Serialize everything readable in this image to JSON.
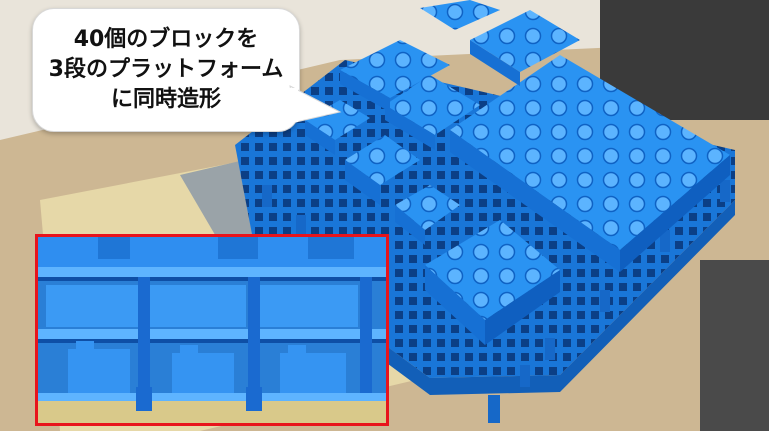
{
  "callout": {
    "lines": [
      "40個のブロックを",
      "3段のプラットフォーム",
      "に同時造形"
    ]
  },
  "colors": {
    "print_blue": "#1f8ef0",
    "inset_border": "#e8141c",
    "bubble_fill": "#ffffff",
    "bubble_text": "#111111"
  },
  "inset": {
    "label": "closeup-of-stacked-platforms"
  }
}
